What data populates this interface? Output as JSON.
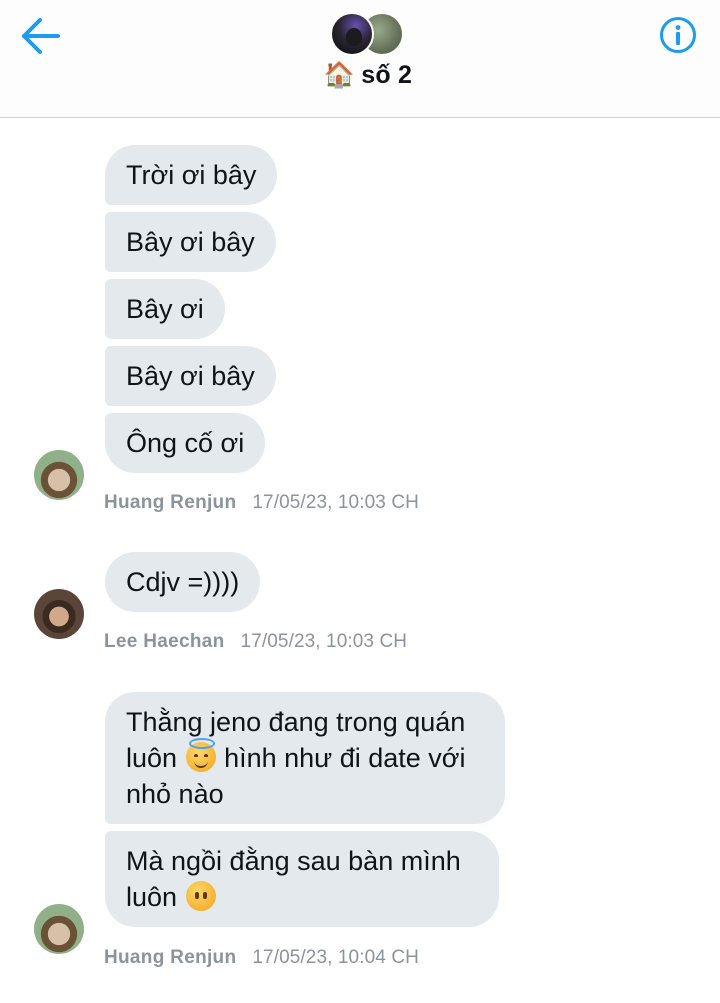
{
  "header": {
    "group_emoji": "🏠",
    "group_name": "số 2",
    "accent_color": "#1d9bf0"
  },
  "icons": {
    "back": "back-arrow-icon",
    "info": "info-icon"
  },
  "messages": [
    {
      "sender": "Huang Renjun",
      "timestamp": "17/05/23, 10:03 CH",
      "bubbles": [
        "Trời ơi bây",
        "Bây ơi bây",
        "Bây ơi",
        "Bây ơi bây",
        "Ông cố ơi"
      ]
    },
    {
      "sender": "Lee Haechan",
      "timestamp": "17/05/23, 10:03 CH",
      "bubbles": [
        "Cdjv =))))"
      ]
    },
    {
      "sender": "Huang Renjun",
      "timestamp": "17/05/23, 10:04 CH",
      "bubbles": [
        {
          "line1": "Thằng jeno đang trong quán",
          "line2a": "luôn",
          "emoji2": "😇",
          "line2b": "hình như đi date với",
          "line3": "nhỏ nào"
        },
        {
          "line1": "Mà ngồi đằng sau bàn mình",
          "line2a": "luôn",
          "emoji2": "😶"
        }
      ]
    }
  ]
}
